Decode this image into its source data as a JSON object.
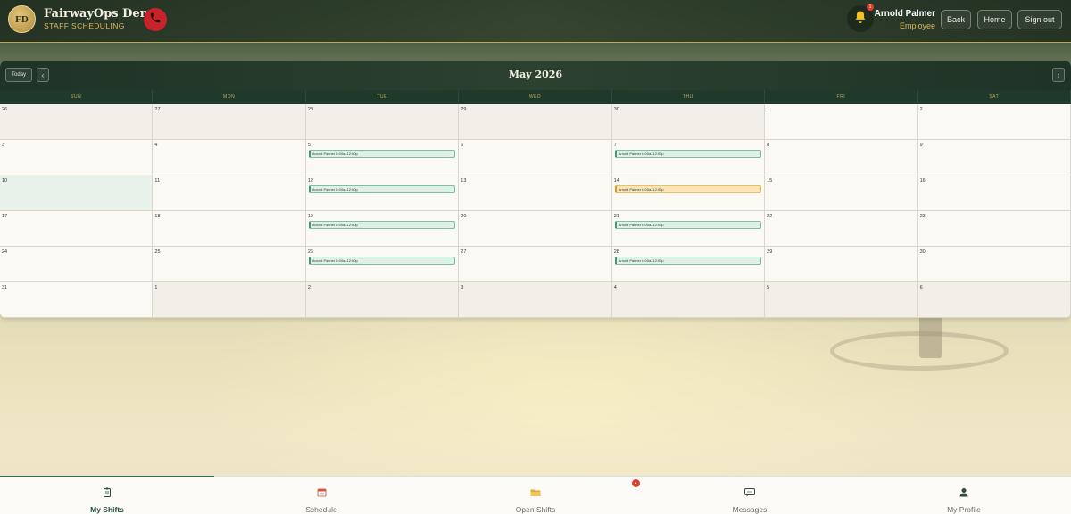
{
  "header": {
    "logo_initials": "FD",
    "app_title": "FairwayOps Demo",
    "app_subtitle": "STAFF SCHEDULING",
    "notification_count": "1",
    "user_name": "Arnold Palmer",
    "user_role": "Employee",
    "back_label": "Back",
    "home_label": "Home",
    "signout_label": "Sign out",
    "icons": {
      "phone": "phone-icon",
      "bell": "bell-icon"
    }
  },
  "calendar": {
    "today_label": "Today",
    "prev_label": "‹",
    "next_label": "›",
    "month_title": "May 2026",
    "weekdays": [
      "SUN",
      "MON",
      "TUE",
      "WED",
      "THU",
      "FRI",
      "SAT"
    ],
    "weeks": [
      [
        {
          "day": "26",
          "other": true
        },
        {
          "day": "27",
          "other": true
        },
        {
          "day": "28",
          "other": true
        },
        {
          "day": "29",
          "other": true
        },
        {
          "day": "30",
          "other": true
        },
        {
          "day": "1"
        },
        {
          "day": "2"
        }
      ],
      [
        {
          "day": "3"
        },
        {
          "day": "4"
        },
        {
          "day": "5",
          "shift": "Arnold Palmer 6:00a–12:00p",
          "status": "confirmed"
        },
        {
          "day": "6"
        },
        {
          "day": "7",
          "shift": "Arnold Palmer 6:00a–12:00p",
          "status": "confirmed"
        },
        {
          "day": "8"
        },
        {
          "day": "9"
        }
      ],
      [
        {
          "day": "10",
          "today": true
        },
        {
          "day": "11"
        },
        {
          "day": "12",
          "shift": "Arnold Palmer 6:00a–12:00p",
          "status": "confirmed"
        },
        {
          "day": "13"
        },
        {
          "day": "14",
          "shift": "Arnold Palmer 6:00a–12:00p",
          "status": "pending"
        },
        {
          "day": "15"
        },
        {
          "day": "16"
        }
      ],
      [
        {
          "day": "17"
        },
        {
          "day": "18"
        },
        {
          "day": "19",
          "shift": "Arnold Palmer 6:00a–12:00p",
          "status": "confirmed"
        },
        {
          "day": "20"
        },
        {
          "day": "21",
          "shift": "Arnold Palmer 6:00a–12:00p",
          "status": "confirmed"
        },
        {
          "day": "22"
        },
        {
          "day": "23"
        }
      ],
      [
        {
          "day": "24"
        },
        {
          "day": "25"
        },
        {
          "day": "26",
          "shift": "Arnold Palmer 6:00a–12:00p",
          "status": "confirmed"
        },
        {
          "day": "27"
        },
        {
          "day": "28",
          "shift": "Arnold Palmer 6:00a–12:00p",
          "status": "confirmed"
        },
        {
          "day": "29"
        },
        {
          "day": "30"
        }
      ],
      [
        {
          "day": "31"
        },
        {
          "day": "1",
          "other": true
        },
        {
          "day": "2",
          "other": true
        },
        {
          "day": "3",
          "other": true
        },
        {
          "day": "4",
          "other": true
        },
        {
          "day": "5",
          "other": true
        },
        {
          "day": "6",
          "other": true
        }
      ]
    ]
  },
  "bottom_nav": {
    "items": [
      {
        "label": "My Shifts",
        "icon": "clipboard-icon",
        "active": true
      },
      {
        "label": "Schedule",
        "icon": "calendar-icon",
        "active": false
      },
      {
        "label": "Open Shifts",
        "icon": "folder-icon",
        "active": false
      },
      {
        "label": "Messages",
        "icon": "chat-icon",
        "active": false
      },
      {
        "label": "My Profile",
        "icon": "user-icon",
        "active": false
      }
    ],
    "open_shifts_badge": "•"
  },
  "colors": {
    "brand_dark": "#1f3326",
    "accent_gold": "#c8a857",
    "shift_confirmed": "#dff1e6",
    "shift_pending": "#fbe6b8",
    "alert_red": "#c8222a"
  }
}
